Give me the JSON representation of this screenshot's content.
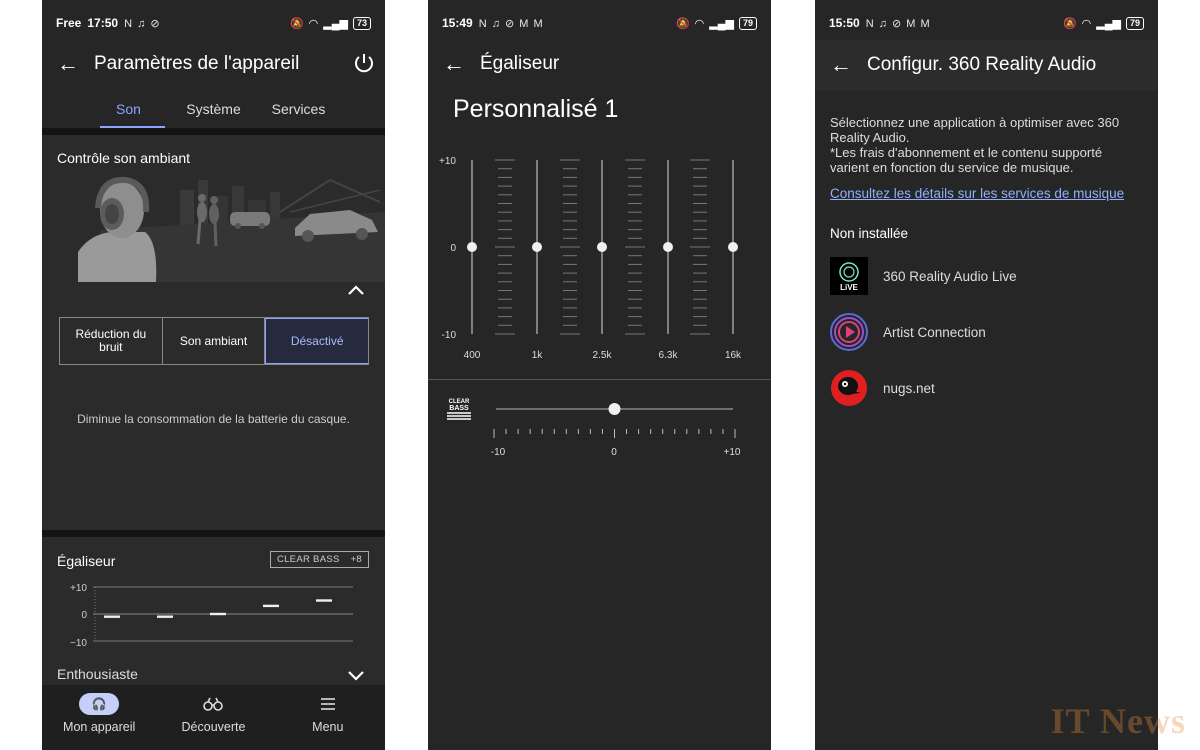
{
  "screen1": {
    "status": {
      "carrier": "Free",
      "time": "17:50",
      "icons": "N ♫ ⊘",
      "battery": "73"
    },
    "title": "Paramètres de l'appareil",
    "tabs": [
      "Son",
      "Système",
      "Services"
    ],
    "active_tab": 0,
    "ambient": {
      "title": "Contrôle son ambiant",
      "options": [
        "Réduction du bruit",
        "Son ambiant",
        "Désactivé"
      ],
      "selected": 2,
      "hint": "Diminue la consommation de la batterie du casque."
    },
    "equalizer": {
      "title": "Égaliseur",
      "clear_bass_label": "CLEAR BASS",
      "clear_bass_value": "+8",
      "y_labels": [
        "+10",
        "0",
        "−10"
      ],
      "band_levels": [
        -1,
        -1,
        0,
        3,
        5
      ],
      "preset": "Enthousiaste"
    },
    "nav": [
      {
        "label": "Mon appareil",
        "icon": "headphones-icon"
      },
      {
        "label": "Découverte",
        "icon": "binoculars-icon"
      },
      {
        "label": "Menu",
        "icon": "menu-icon"
      }
    ]
  },
  "screen2": {
    "status": {
      "time": "15:49",
      "icons": "N ♫ ⊘ M M",
      "battery": "79"
    },
    "title": "Égaliseur",
    "preset_name": "Personnalisé 1",
    "y_labels": [
      "+10",
      "0",
      "-10"
    ],
    "band_labels": [
      "400",
      "1k",
      "2.5k",
      "6.3k",
      "16k"
    ],
    "bands": [
      0,
      0,
      0,
      0,
      0
    ],
    "clear_bass": {
      "label_top": "CLEAR",
      "label_bottom": "BASS",
      "value": 0,
      "min_label": "-10",
      "mid_label": "0",
      "max_label": "+10"
    }
  },
  "screen3": {
    "status": {
      "time": "15:50",
      "icons": "N ♫ ⊘ M M",
      "battery": "79"
    },
    "title": "Configur. 360 Reality Audio",
    "description_1": "Sélectionnez une application à optimiser avec 360 Reality Audio.",
    "description_2": "*Les frais d'abonnement et le contenu supporté varient en fonction du service de musique.",
    "link": "Consultez les détails sur les services de musique",
    "section": "Non installée",
    "apps": [
      {
        "name": "360 Reality Audio Live",
        "badge": "LiVE"
      },
      {
        "name": "Artist Connection"
      },
      {
        "name": "nugs.net"
      }
    ]
  },
  "watermark": "IT News",
  "colors": {
    "accent": "#8aa4ff",
    "background": "#262626",
    "nugs_red": "#e02020"
  }
}
